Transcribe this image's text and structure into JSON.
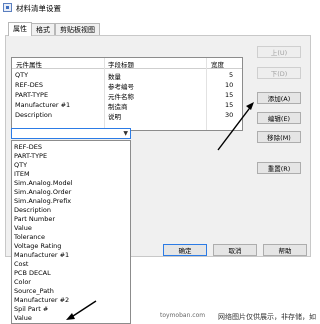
{
  "window": {
    "title": "材料清单设置"
  },
  "tabs": [
    {
      "label": "属性",
      "active": true
    },
    {
      "label": "格式",
      "active": false
    },
    {
      "label": "剪贴板视图",
      "active": false
    }
  ],
  "table": {
    "columns": [
      "元件属性",
      "字段标题",
      "宽度"
    ],
    "rows": [
      {
        "attr": "QTY",
        "title": "数量",
        "width": "5"
      },
      {
        "attr": "REF-DES",
        "title": "参考编号",
        "width": "10"
      },
      {
        "attr": "PART-TYPE",
        "title": "元件名称",
        "width": "15"
      },
      {
        "attr": "Manufacturer #1",
        "title": "制造商",
        "width": "15"
      },
      {
        "attr": "Description",
        "title": "说明",
        "width": "30"
      }
    ]
  },
  "side_buttons": {
    "up": "上(U)",
    "down": "下(D)",
    "add": "添加(A)",
    "edit": "编辑(E)",
    "remove": "移除(M)",
    "reset": "重置(R)"
  },
  "combo": {
    "value": ""
  },
  "dropdown_options": [
    "REF-DES",
    "PART-TYPE",
    "QTY",
    "ITEM",
    "Sim.Analog.Model",
    "Sim.Analog.Order",
    "Sim.Analog.Prefix",
    "Description",
    "Part Number",
    "Value",
    "Tolerance",
    "Voltage Rating",
    "Manufacturer #1",
    "Cost",
    "PCB DECAL",
    "Color",
    "Source_Path",
    "Manufacturer #2",
    "Spil Part #",
    "Value"
  ],
  "footer_buttons": {
    "ok": "确定",
    "cancel": "取消",
    "help": "帮助"
  },
  "watermark": {
    "text": "网络图片仅供展示，非存储，如",
    "host": "toymoban.com"
  },
  "colors": {
    "accent": "#2c7be5",
    "border": "#8c8c8c",
    "button_bg": "#e5e5e5"
  }
}
